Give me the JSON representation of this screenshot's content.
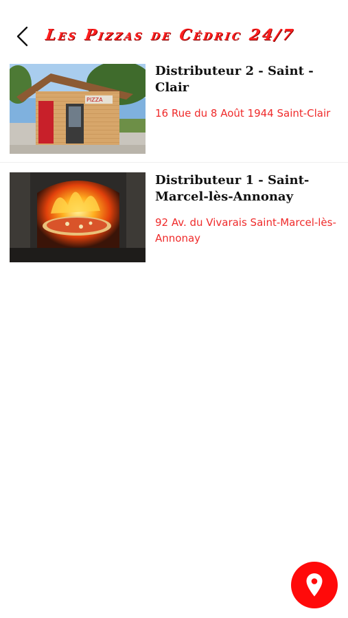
{
  "header": {
    "back_icon": "chevron-left-icon",
    "title": "Les Pizzas de Cédric 24/7"
  },
  "locations": [
    {
      "name": "Distributeur 2 - Saint -Clair",
      "address": "16 Rue du 8 Août 1944 Saint-Clair",
      "image_icon": "kiosk-photo"
    },
    {
      "name": "Distributeur 1 - Saint-Marcel-lès-Annonay",
      "address": "92 Av. du Vivarais Saint-Marcel-lès-Annonay",
      "image_icon": "pizza-oven-photo"
    }
  ],
  "fab": {
    "icon": "map-pin-icon",
    "color": "#ff0a0a"
  },
  "colors": {
    "accent": "#ef2a2a",
    "title": "#ff1f1f"
  }
}
